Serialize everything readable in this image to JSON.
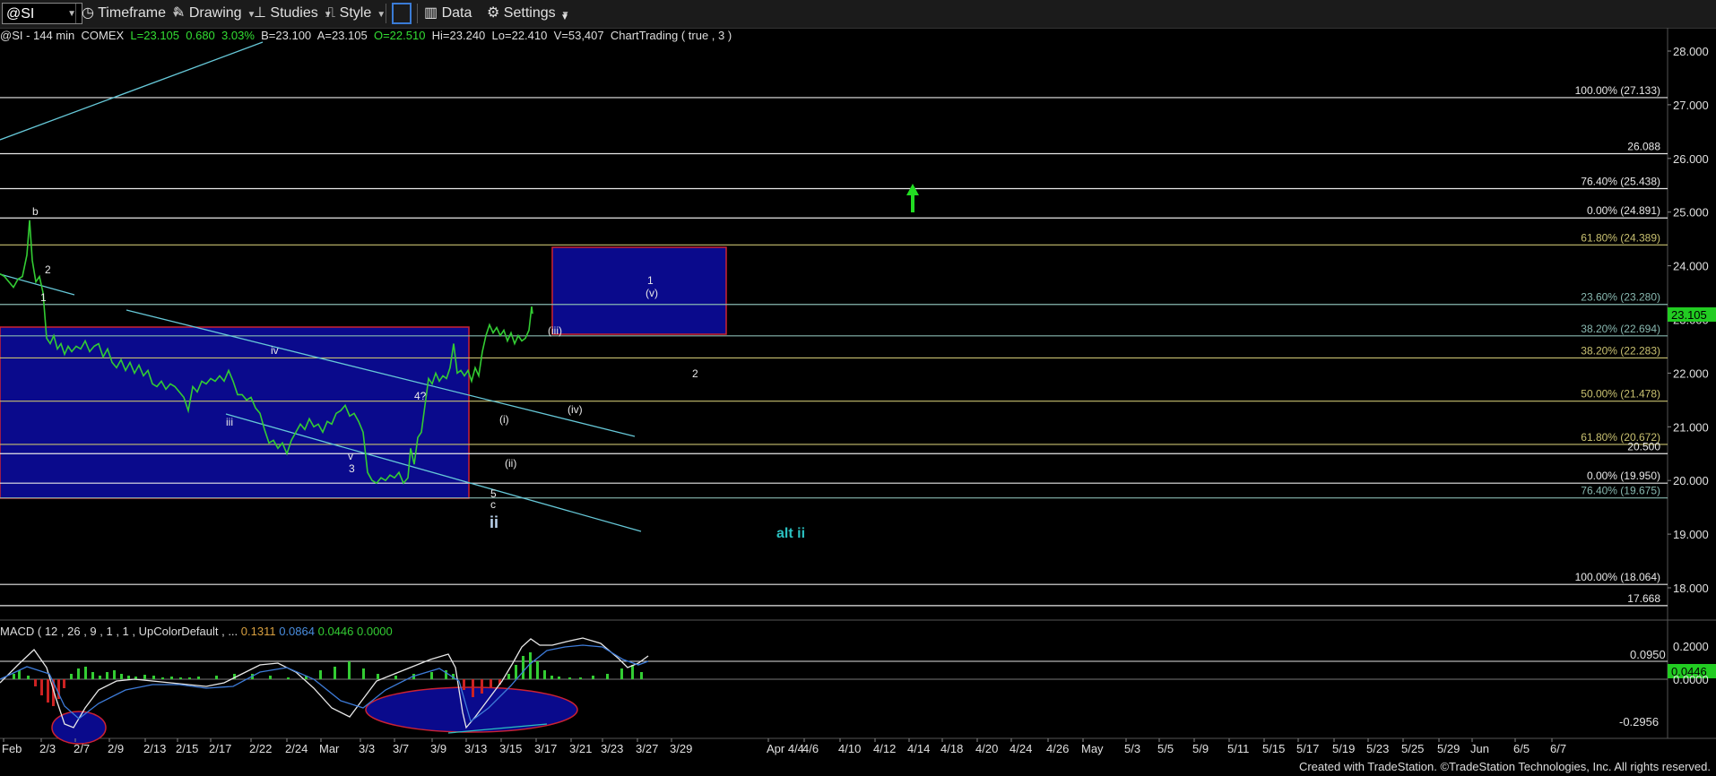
{
  "toolbar": {
    "symbol": "@SI",
    "timeframe_label": "Timeframe",
    "drawing_label": "Drawing",
    "studies_label": "Studies",
    "style_label": "Style",
    "data_label": "Data",
    "settings_label": "Settings"
  },
  "info": {
    "symbol": "@SI - 144 min",
    "exchange": "COMEX",
    "last": "L=23.105",
    "change": "0.680",
    "change_pct": "3.03%",
    "bid": "B=23.100",
    "ask": "A=23.105",
    "open": "O=22.510",
    "high": "Hi=23.240",
    "low": "Lo=22.410",
    "volume": "V=53,407",
    "study": "ChartTrading ( true , 3 )"
  },
  "macd": {
    "label": "MACD ( 12 , 26 , 9 , 1 , 1 , UpColorDefault , ...",
    "v1": "0.1311",
    "v2": "0.0864",
    "v3": "0.0446",
    "v4": "0.0000"
  },
  "footer": "Created with TradeStation. ©TradeStation Technologies, Inc. All rights reserved.",
  "colors": {
    "background": "#000000",
    "price_up": "#33cc33",
    "box_fill": "#0a0a8c",
    "box_border": "#cc2233",
    "trendline": "#66c8d8",
    "fib_olive": "#c8c070",
    "fib_white": "#e8e8e8",
    "fib_teal": "#88b8b0",
    "last_price_bg": "#22cc22",
    "arrow": "#22dd22"
  },
  "chart_data": {
    "type": "line",
    "instrument": "@SI - 144 min COMEX",
    "last_price": "23.105",
    "y_ticks": [
      "28.000",
      "27.000",
      "26.000",
      "25.000",
      "24.000",
      "23.000",
      "22.000",
      "21.000",
      "20.000",
      "19.000",
      "18.000"
    ],
    "ylim": [
      17.0,
      28.3
    ],
    "x_ticks": [
      "Feb",
      "2/3",
      "2/7",
      "2/9",
      "2/13",
      "2/15",
      "2/17",
      "2/22",
      "2/24",
      "Mar",
      "3/3",
      "3/7",
      "3/9",
      "3/13",
      "3/15",
      "3/17",
      "3/21",
      "3/23",
      "3/27",
      "3/29",
      "Apr 4/4",
      "4/6",
      "4/10",
      "4/12",
      "4/14",
      "4/18",
      "4/20",
      "4/24",
      "4/26",
      "May",
      "5/3",
      "5/5",
      "5/9",
      "5/11",
      "5/15",
      "5/17",
      "5/19",
      "5/23",
      "5/25",
      "5/29",
      "Jun",
      "6/5",
      "6/7"
    ],
    "levels": [
      {
        "label": "100.00% (27.133)",
        "value": 27.133,
        "color": "#e8e8e8"
      },
      {
        "label": "26.088",
        "value": 26.088,
        "color": "#e8e8e8"
      },
      {
        "label": "76.40% (25.438)",
        "value": 25.438,
        "color": "#e8e8e8"
      },
      {
        "label": "0.00% (24.891)",
        "value": 24.891,
        "color": "#e8e8e8"
      },
      {
        "label": "61.80% (24.389)",
        "value": 24.389,
        "color": "#c8c070"
      },
      {
        "label": "23.60% (23.280)",
        "value": 23.28,
        "color": "#88b8b0"
      },
      {
        "label": "38.20% (22.694)",
        "value": 22.694,
        "color": "#88b8b0"
      },
      {
        "label": "38.20% (22.283)",
        "value": 22.283,
        "color": "#c8c070"
      },
      {
        "label": "50.00% (21.478)",
        "value": 21.478,
        "color": "#c8c070"
      },
      {
        "label": "61.80% (20.672)",
        "value": 20.672,
        "color": "#c8c070"
      },
      {
        "label": "20.500",
        "value": 20.5,
        "color": "#e8e8e8"
      },
      {
        "label": "0.00% (19.950)",
        "value": 19.95,
        "color": "#e8e8e8"
      },
      {
        "label": "76.40% (19.675)",
        "value": 19.675,
        "color": "#88b8b0"
      },
      {
        "label": "100.00% (18.064)",
        "value": 18.064,
        "color": "#e8e8e8"
      },
      {
        "label": "17.668",
        "value": 17.668,
        "color": "#e8e8e8"
      }
    ],
    "series": [
      {
        "values": [
          [
            0,
            23.85
          ],
          [
            5,
            23.8
          ],
          [
            10,
            23.7
          ],
          [
            15,
            23.6
          ],
          [
            20,
            23.75
          ],
          [
            25,
            23.8
          ],
          [
            30,
            24.2
          ],
          [
            33,
            24.85
          ],
          [
            36,
            24.1
          ],
          [
            40,
            23.7
          ],
          [
            44,
            23.8
          ],
          [
            48,
            23.5
          ],
          [
            52,
            22.65
          ],
          [
            56,
            22.55
          ],
          [
            60,
            22.7
          ],
          [
            64,
            22.45
          ],
          [
            68,
            22.55
          ],
          [
            72,
            22.35
          ],
          [
            76,
            22.5
          ],
          [
            80,
            22.4
          ],
          [
            85,
            22.5
          ],
          [
            90,
            22.45
          ],
          [
            95,
            22.6
          ],
          [
            100,
            22.4
          ],
          [
            105,
            22.5
          ],
          [
            110,
            22.55
          ],
          [
            115,
            22.3
          ],
          [
            120,
            22.45
          ],
          [
            125,
            22.2
          ],
          [
            130,
            22.1
          ],
          [
            135,
            22.25
          ],
          [
            140,
            22.05
          ],
          [
            145,
            22.2
          ],
          [
            150,
            22.0
          ],
          [
            155,
            22.15
          ],
          [
            160,
            21.95
          ],
          [
            165,
            22.05
          ],
          [
            170,
            21.8
          ],
          [
            175,
            21.75
          ],
          [
            180,
            21.85
          ],
          [
            185,
            21.7
          ],
          [
            190,
            21.8
          ],
          [
            195,
            21.75
          ],
          [
            200,
            21.65
          ],
          [
            205,
            21.55
          ],
          [
            210,
            21.3
          ],
          [
            215,
            21.75
          ],
          [
            220,
            21.65
          ],
          [
            225,
            21.85
          ],
          [
            230,
            21.8
          ],
          [
            235,
            21.9
          ],
          [
            240,
            21.85
          ],
          [
            245,
            21.95
          ],
          [
            250,
            21.85
          ],
          [
            255,
            22.05
          ],
          [
            260,
            21.85
          ],
          [
            265,
            21.6
          ],
          [
            270,
            21.6
          ],
          [
            275,
            21.5
          ],
          [
            280,
            21.55
          ],
          [
            285,
            21.35
          ],
          [
            290,
            21.25
          ],
          [
            295,
            20.95
          ],
          [
            300,
            20.7
          ],
          [
            305,
            20.75
          ],
          [
            310,
            20.6
          ],
          [
            315,
            20.7
          ],
          [
            320,
            20.5
          ],
          [
            325,
            20.75
          ],
          [
            330,
            20.9
          ],
          [
            335,
            21.05
          ],
          [
            340,
            20.95
          ],
          [
            345,
            21.15
          ],
          [
            350,
            21.0
          ],
          [
            355,
            21.05
          ],
          [
            360,
            20.9
          ],
          [
            365,
            21.1
          ],
          [
            370,
            21.05
          ],
          [
            375,
            21.25
          ],
          [
            380,
            21.3
          ],
          [
            385,
            21.4
          ],
          [
            390,
            21.2
          ],
          [
            395,
            21.25
          ],
          [
            400,
            21.1
          ],
          [
            405,
            20.9
          ],
          [
            410,
            20.15
          ],
          [
            415,
            20.0
          ],
          [
            420,
            19.95
          ],
          [
            425,
            20.05
          ],
          [
            430,
            20.0
          ],
          [
            435,
            20.1
          ],
          [
            440,
            20.05
          ],
          [
            445,
            20.15
          ],
          [
            450,
            19.95
          ],
          [
            455,
            20.05
          ],
          [
            458,
            20.6
          ],
          [
            462,
            20.3
          ],
          [
            466,
            20.8
          ],
          [
            470,
            20.9
          ],
          [
            474,
            21.4
          ],
          [
            478,
            21.9
          ],
          [
            482,
            21.8
          ],
          [
            486,
            22.0
          ],
          [
            490,
            21.85
          ],
          [
            494,
            21.95
          ],
          [
            498,
            21.9
          ],
          [
            502,
            22.1
          ],
          [
            506,
            22.55
          ],
          [
            510,
            22.0
          ],
          [
            514,
            22.05
          ],
          [
            518,
            21.95
          ],
          [
            522,
            22.05
          ],
          [
            526,
            21.85
          ],
          [
            530,
            22.1
          ],
          [
            534,
            21.95
          ],
          [
            538,
            22.4
          ],
          [
            542,
            22.7
          ],
          [
            546,
            22.9
          ],
          [
            550,
            22.75
          ],
          [
            554,
            22.85
          ],
          [
            558,
            22.7
          ],
          [
            562,
            22.8
          ],
          [
            566,
            22.6
          ],
          [
            570,
            22.75
          ],
          [
            574,
            22.55
          ],
          [
            578,
            22.7
          ],
          [
            582,
            22.6
          ],
          [
            586,
            22.65
          ],
          [
            590,
            22.8
          ],
          [
            593,
            23.24
          ],
          [
            594,
            23.105
          ]
        ]
      }
    ],
    "annotations": [
      "b",
      "2",
      "1",
      "iv",
      "iii",
      "v",
      "3",
      "4?",
      "5",
      "c",
      "ii",
      "(i)",
      "(ii)",
      "(iii)",
      "(iv)",
      "1",
      "(v)",
      "2",
      "alt ii"
    ],
    "macd_ticks": [
      "0.2000",
      "0.0950",
      "0.0446",
      "0.0000",
      "-0.2956"
    ]
  }
}
